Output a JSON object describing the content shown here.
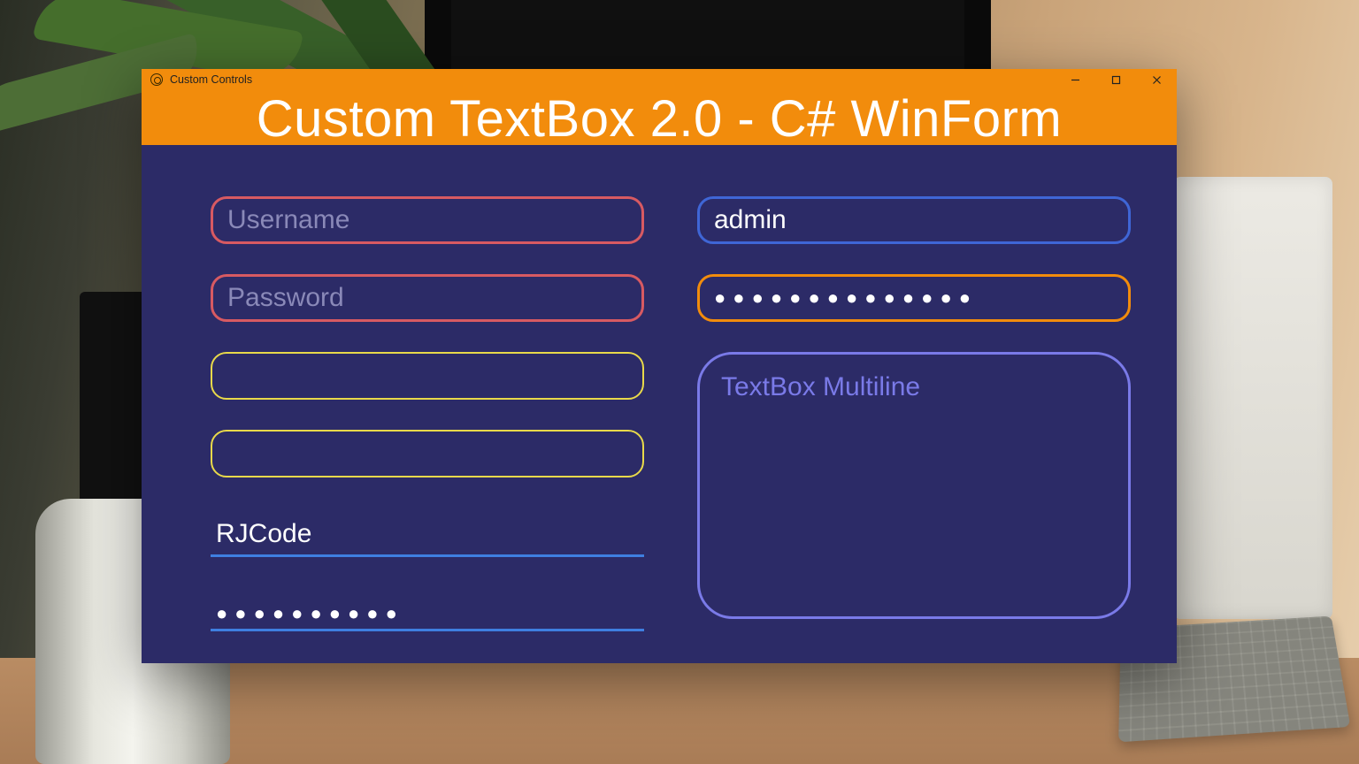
{
  "window": {
    "title": "Custom Controls",
    "banner": "Custom TextBox 2.0 - C# WinForm"
  },
  "left": {
    "username_placeholder": "Username",
    "password_placeholder": "Password",
    "rjcode_value": "RJCode",
    "underline_password_value": "●●●●●●●●●●"
  },
  "right": {
    "admin_value": "admin",
    "password_value": "●●●●●●●●●●●●●●",
    "multiline_placeholder": "TextBox Multiline"
  },
  "colors": {
    "header": "#f28c0c",
    "body": "#2c2b67",
    "border_red": "#d85a62",
    "border_yellow": "#e8d94a",
    "border_blue": "#3f66d6",
    "border_orange": "#f28c0c",
    "border_violet": "#7a7ae8",
    "underline_blue": "#3f7fe0"
  }
}
